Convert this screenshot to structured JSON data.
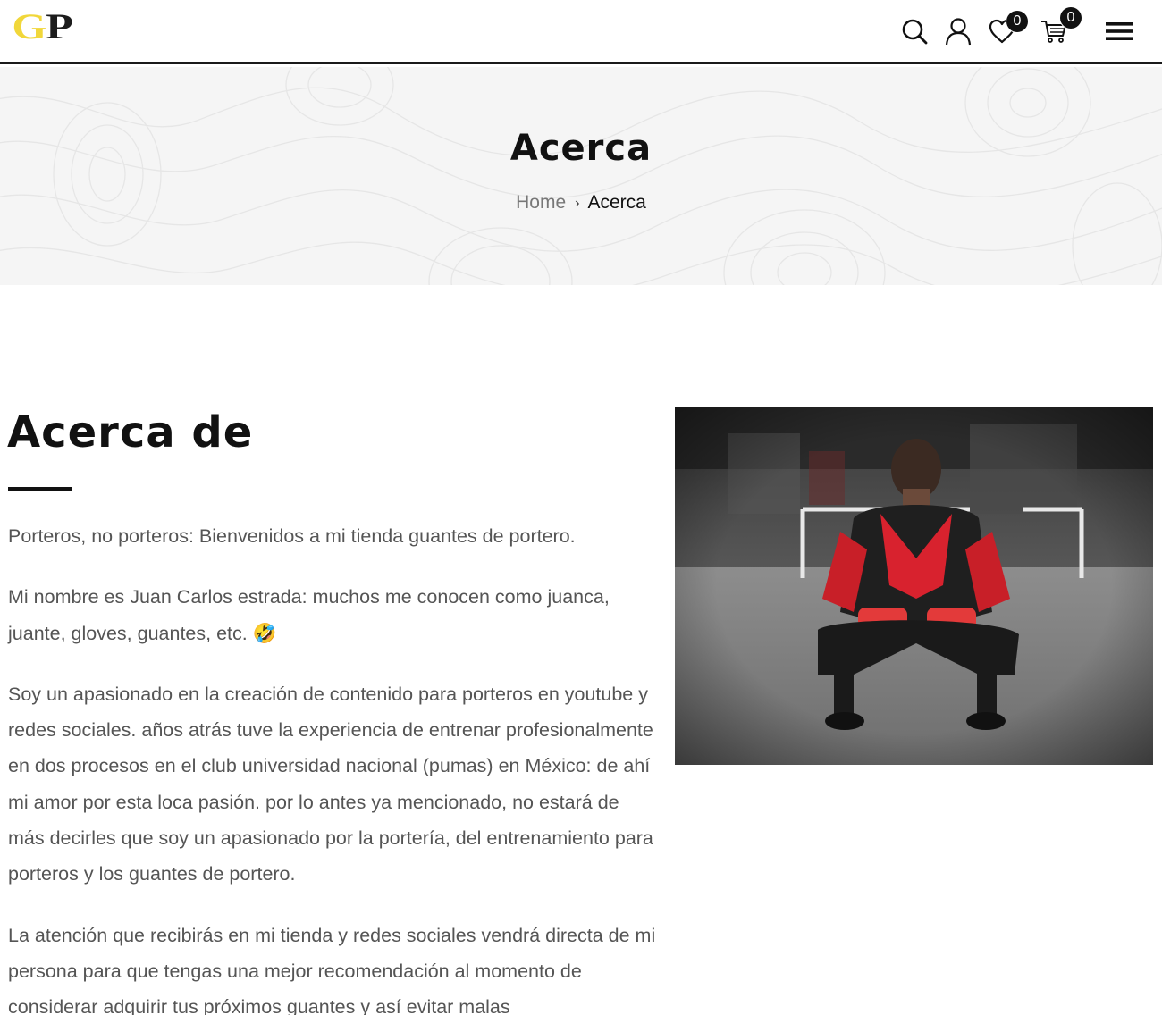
{
  "header": {
    "logo": {
      "g": "G",
      "p": "P"
    },
    "icons": [
      "search-icon",
      "user-icon",
      "heart-icon",
      "cart-icon",
      "menu-icon"
    ],
    "wishlist_count": "0",
    "cart_count": "0"
  },
  "banner": {
    "title": "Acerca",
    "breadcrumb": {
      "home": "Home",
      "separator": "›",
      "current": "Acerca"
    }
  },
  "main": {
    "heading": "Acerca de",
    "paragraphs": [
      "Porteros, no porteros: Bienvenidos a mi tienda guantes de portero.",
      "Mi nombre es Juan Carlos estrada: muchos me conocen como juanca, juante, gloves, guantes, etc. 🤣",
      "Soy un apasionado en la creación de contenido para porteros en youtube y redes sociales. años atrás tuve la experiencia de entrenar profesionalmente en dos procesos en el club universidad nacional (pumas) en México: de ahí mi amor por esta loca pasión. por lo antes ya mencionado, no estará de más decirles que soy un apasionado por la portería, del entrenamiento para porteros y los guantes de portero.",
      "La atención que recibirás en mi tienda y redes sociales vendrá directa de mi persona para que tengas una mejor recomendación al momento de considerar adquirir tus próximos guantes y así evitar malas"
    ]
  },
  "colors": {
    "logo_yellow": "#f1d73a",
    "header_border": "#1a1a1a",
    "banner_bg": "#f5f5f5",
    "kit_red": "#d8222e"
  }
}
